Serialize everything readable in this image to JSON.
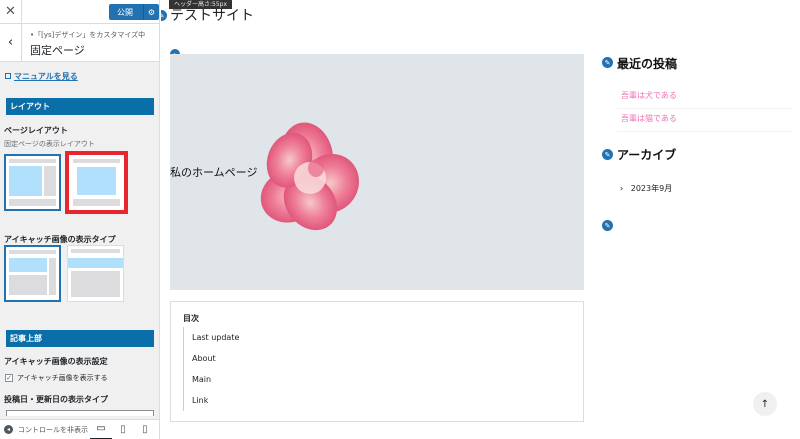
{
  "customizer": {
    "close_icon": "✕",
    "publish_label": "公開",
    "gear_icon": "⚙",
    "back_icon": "‹",
    "breadcrumb": "•「[ys]デザイン」をカスタマイズ中",
    "heading": "固定ページ",
    "manual_link": "マニュアルを見る",
    "section_layout": "レイアウト",
    "page_layout_label": "ページレイアウト",
    "page_layout_desc": "固定ページの表示レイアウト",
    "thumbnail_type_label": "アイキャッチ画像の表示タイプ",
    "section_article_top": "記事上部",
    "thumbnail_setting_label": "アイキャッチ画像の表示設定",
    "thumbnail_checkbox_label": "アイキャッチ画像を表示する",
    "thumbnail_checkbox_checked": true,
    "date_type_label": "投稿日・更新日の表示タイプ",
    "hide_controls_label": "コントロールを非表示",
    "colors": {
      "accent": "#2271b1",
      "section": "#0a6ea8",
      "highlight": "#e8262d",
      "thumb_blue": "#b1e0fc"
    }
  },
  "preview": {
    "header_height_tooltip": "ヘッダー高さ:55px",
    "site_title": "テストサイト",
    "hero_text": "私のホームページ",
    "toc_title": "目次",
    "toc_items": [
      "Last update",
      "About",
      "Main",
      "Link"
    ],
    "recent_posts_title": "最近の投稿",
    "recent_posts": [
      "吾輩は犬である",
      "吾輩は猫である"
    ],
    "archive_title": "アーカイブ",
    "archive_items": [
      "2023年9月"
    ],
    "link_color": "#f070b4"
  }
}
